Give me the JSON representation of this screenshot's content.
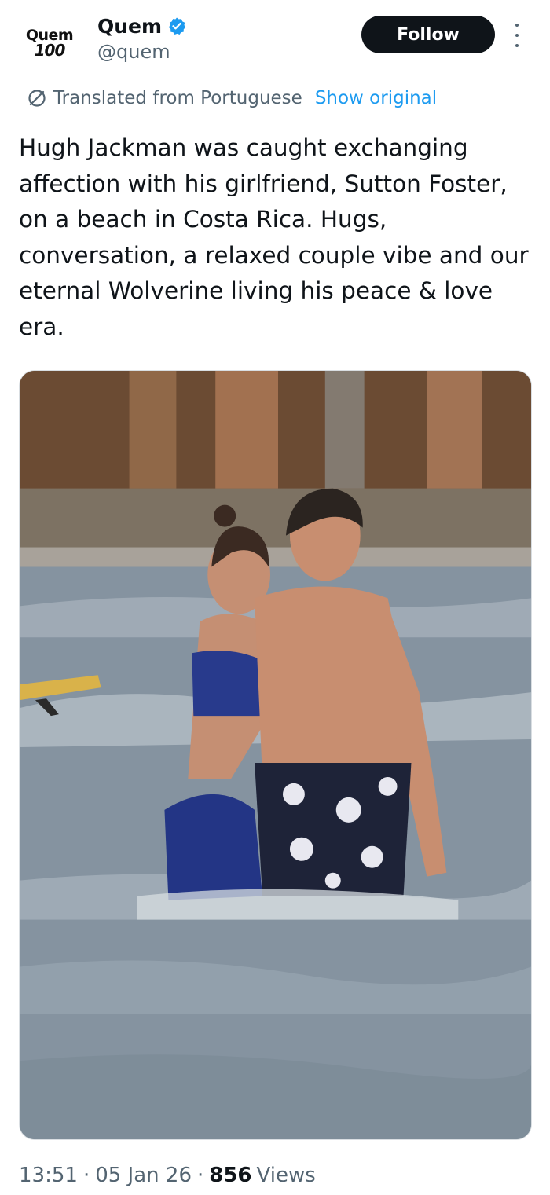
{
  "account": {
    "avatar_logo_top": "Quem",
    "avatar_logo_bottom": "100",
    "display_name": "Quem",
    "handle": "@quem",
    "verified": true,
    "verified_color": "#1d9bf0"
  },
  "actions": {
    "follow_label": "Follow",
    "more_icon": "more-vertical-icon"
  },
  "translation": {
    "icon": "translate-icon",
    "label": "Translated from Portuguese",
    "show_original_label": "Show original"
  },
  "tweet": {
    "text": "Hugh Jackman was caught exchanging affection with his girlfriend, Sutton Foster, on a beach in Costa Rica. Hugs, conversation, a relaxed couple vibe and our eternal Wolverine living his peace & love era."
  },
  "meta": {
    "time": "13:51",
    "separator": "·",
    "date": "05 Jan 26",
    "views_count": "856",
    "views_label": "Views"
  },
  "colors": {
    "text_primary": "#0f1419",
    "text_secondary": "#536471",
    "link": "#1d9bf0",
    "button_bg": "#0f1419"
  }
}
